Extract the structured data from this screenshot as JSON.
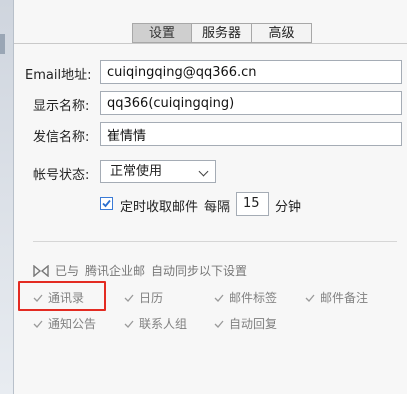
{
  "tabs": [
    {
      "label": "设置"
    },
    {
      "label": "服务器"
    },
    {
      "label": "高级"
    }
  ],
  "form": {
    "email_label": "Email地址:",
    "email_value": "cuiqingqing@qq366.cn",
    "display_label": "显示名称:",
    "display_value": "qq366(cuiqingqing)",
    "sender_label": "发信名称:",
    "sender_value": "崔情情",
    "status_label": "帐号状态:",
    "status_value": "正常使用"
  },
  "schedule": {
    "checkbox_label": "定时收取邮件",
    "checked": true,
    "every_label": "每隔",
    "interval": "15",
    "unit_label": "分钟"
  },
  "sync": {
    "prefix": "已与",
    "provider": "腾讯企业邮",
    "suffix": "自动同步以下设置",
    "items": [
      {
        "label": "通讯录"
      },
      {
        "label": "日历"
      },
      {
        "label": "邮件标签"
      },
      {
        "label": "邮件备注"
      },
      {
        "label": "通知公告"
      },
      {
        "label": "联系人组"
      },
      {
        "label": "自动回复"
      }
    ]
  },
  "colors": {
    "highlight": "#e32b22",
    "checkbox": "#3b7bd6",
    "muted_text": "#808080"
  },
  "icons": {
    "sync": "sync-link-icon",
    "item_check": "check-icon",
    "dropdown": "chevron-down-icon"
  }
}
